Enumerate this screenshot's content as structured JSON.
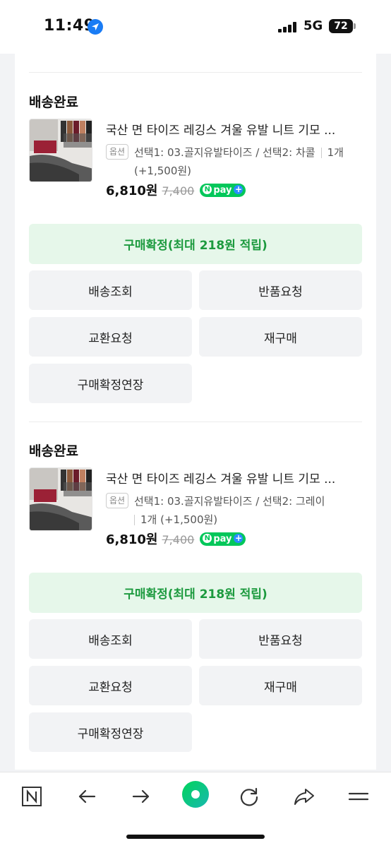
{
  "status_bar": {
    "time": "11:49",
    "network": "5G",
    "battery": "72"
  },
  "orders": [
    {
      "status": "배송완료",
      "product_name": "국산 면 타이즈 레깅스 겨울 유발 니트 기모 ...",
      "option_badge": "옵션",
      "option_text": "선택1: 03.골지유발타이즈 / 선택2: 차콜",
      "quantity": "1개",
      "extra": "(+1,500원)",
      "price": "6,810원",
      "original_price": "7,400",
      "npay_label": "pay",
      "buttons": {
        "confirm": "구매확정(최대 218원 적립)",
        "track": "배송조회",
        "return": "반품요청",
        "exchange": "교환요청",
        "rebuy": "재구매",
        "extend": "구매확정연장"
      }
    },
    {
      "status": "배송완료",
      "product_name": "국산 면 타이즈 레깅스 겨울 유발 니트 기모 ...",
      "option_badge": "옵션",
      "option_text": "선택1: 03.골지유발타이즈 / 선택2: 그레이",
      "quantity": "1개",
      "extra": "(+1,500원)",
      "price": "6,810원",
      "original_price": "7,400",
      "npay_label": "pay",
      "buttons": {
        "confirm": "구매확정(최대 218원 적립)",
        "track": "배송조회",
        "return": "반품요청",
        "exchange": "교환요청",
        "rebuy": "재구매",
        "extend": "구매확정연장"
      }
    }
  ],
  "toolbar": {
    "icons": [
      "naver-n-icon",
      "back-arrow-icon",
      "forward-arrow-icon",
      "green-dot-home-icon",
      "refresh-icon",
      "share-icon",
      "menu-icon"
    ]
  },
  "colors": {
    "confirm_green": "#1c9a3e",
    "confirm_bg": "#e6f7ea",
    "npay_green": "#03c75a",
    "button_gray": "#f2f3f5"
  }
}
